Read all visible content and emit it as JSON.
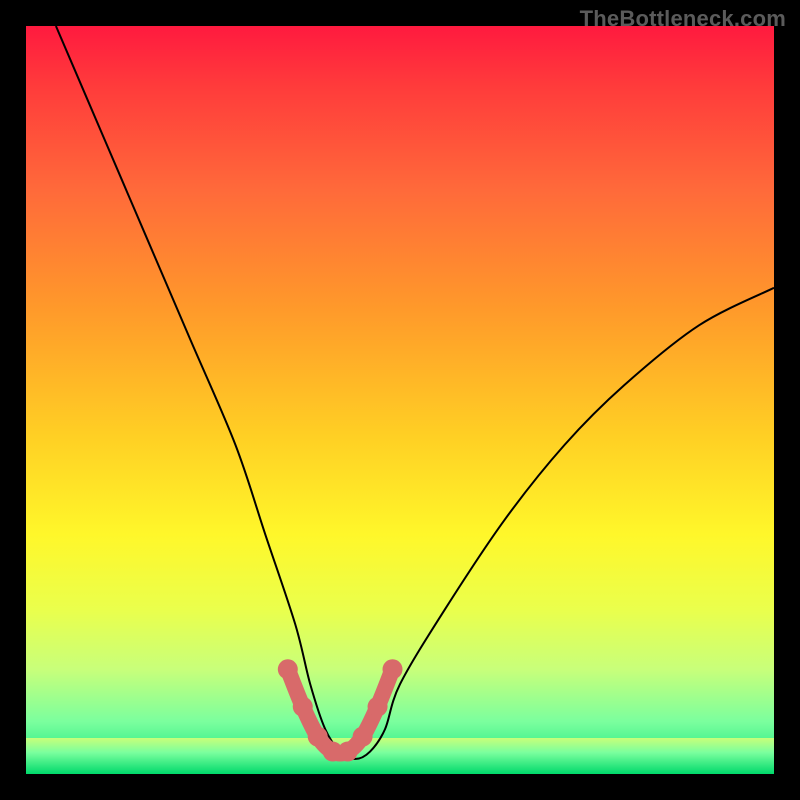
{
  "watermark": "TheBottleneck.com",
  "chart_data": {
    "type": "line",
    "title": "",
    "xlabel": "",
    "ylabel": "",
    "xlim": [
      0,
      100
    ],
    "ylim": [
      0,
      100
    ],
    "grid": false,
    "legend": false,
    "series": [
      {
        "name": "bottleneck-curve",
        "color": "#000000",
        "x": [
          4,
          10,
          16,
          22,
          28,
          32,
          36,
          38,
          40,
          42,
          44,
          46,
          48,
          50,
          56,
          64,
          72,
          80,
          90,
          100
        ],
        "y": [
          100,
          86,
          72,
          58,
          44,
          32,
          20,
          12,
          6,
          3,
          2,
          3,
          6,
          12,
          22,
          34,
          44,
          52,
          60,
          65
        ]
      },
      {
        "name": "highlight-dots",
        "color": "#d86a6a",
        "x": [
          35,
          37,
          39,
          41,
          43,
          45,
          47,
          49
        ],
        "y": [
          14,
          9,
          5,
          3,
          3,
          5,
          9,
          14
        ]
      }
    ],
    "background_gradient": {
      "top": "#ff1a3f",
      "mid": "#fff72a",
      "bottom": "#06e27a"
    }
  }
}
